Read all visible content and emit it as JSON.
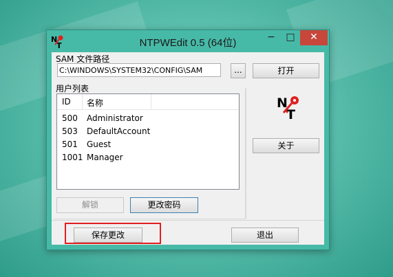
{
  "window": {
    "title": "NTPWEdit 0.5 (64位)",
    "controls": {
      "minimize": "−",
      "maximize": "□",
      "close": "✕"
    }
  },
  "sam": {
    "label": "SAM 文件路径",
    "path": "C:\\WINDOWS\\SYSTEM32\\CONFIG\\SAM",
    "browse_label": "...",
    "open_label": "打开"
  },
  "users": {
    "label": "用户列表",
    "columns": [
      "ID",
      "名称"
    ],
    "rows": [
      {
        "id": "500",
        "name": "Administrator"
      },
      {
        "id": "503",
        "name": "DefaultAccount"
      },
      {
        "id": "501",
        "name": "Guest"
      },
      {
        "id": "1001",
        "name": "Manager"
      }
    ],
    "unlock_label": "解锁",
    "change_password_label": "更改密码"
  },
  "about_label": "关于",
  "footer": {
    "save_label": "保存更改",
    "exit_label": "退出"
  },
  "colors": {
    "highlight": "#e21d1d",
    "close_button": "#c7473b",
    "frame": "#47b9a7"
  }
}
